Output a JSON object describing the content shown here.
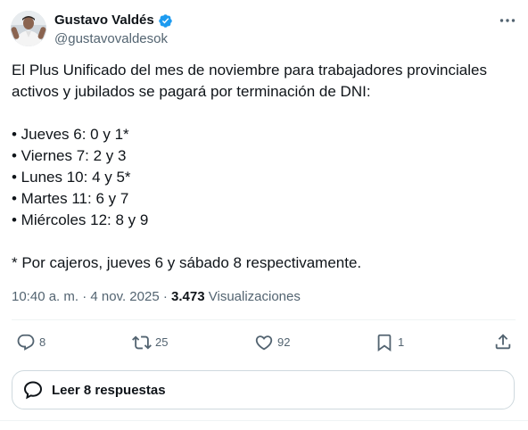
{
  "author": {
    "name": "Gustavo Valdés",
    "handle": "@gustavovaldesok",
    "verified": true,
    "avatar_icon": "profile-photo"
  },
  "post": {
    "lines": [
      "El Plus Unificado del mes de noviembre para trabajadores provinciales",
      "activos y jubilados se pagará por terminación de DNI:",
      "",
      "• Jueves 6: 0 y 1*",
      "• Viernes 7: 2 y 3",
      "• Lunes 10: 4 y 5*",
      "• Martes 11: 6 y 7",
      "• Miércoles 12: 8 y 9",
      "",
      "* Por cajeros, jueves 6 y sábado 8 respectivamente."
    ]
  },
  "meta": {
    "time": "10:40 a. m.",
    "separator": "·",
    "date": "4 nov. 2025",
    "views_count": "3.473",
    "views_label": "Visualizaciones"
  },
  "actions": {
    "reply_count": "8",
    "repost_count": "25",
    "like_count": "92",
    "bookmark_count": "1"
  },
  "replies": {
    "label": "Leer 8 respuestas"
  },
  "colors": {
    "text": "#0f1419",
    "secondary": "#536471",
    "verified": "#1d9bf0",
    "border": "#cfd9de"
  }
}
